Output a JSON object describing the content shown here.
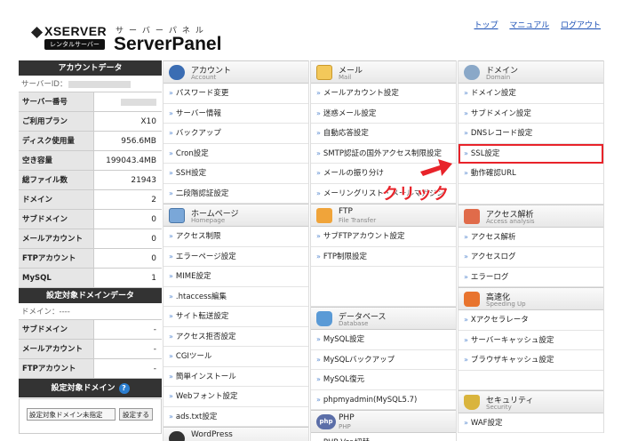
{
  "header": {
    "logo_text": "XSERVER",
    "logo_badge": "レンタルサーバー",
    "panel_sub": "サーバーパネル",
    "panel_title": "ServerPanel",
    "links": [
      "トップ",
      "マニュアル",
      "ログアウト"
    ]
  },
  "sidebar": {
    "account_title": "アカウントデータ",
    "server_id_label": "サーバーID：",
    "account_rows": [
      {
        "label": "サーバー番号",
        "value": ""
      },
      {
        "label": "ご利用プラン",
        "value": "X10"
      },
      {
        "label": "ディスク使用量",
        "value": "956.6MB"
      },
      {
        "label": "空き容量",
        "value": "199043.4MB"
      },
      {
        "label": "総ファイル数",
        "value": "21943"
      },
      {
        "label": "ドメイン",
        "value": "2"
      },
      {
        "label": "サブドメイン",
        "value": "0"
      },
      {
        "label": "メールアカウント",
        "value": "0"
      },
      {
        "label": "FTPアカウント",
        "value": "0"
      },
      {
        "label": "MySQL",
        "value": "1"
      }
    ],
    "domain_data_title": "設定対象ドメインデータ",
    "domain_label": "ドメイン：----",
    "domain_rows": [
      {
        "label": "サブドメイン",
        "value": "-"
      },
      {
        "label": "メールアカウント",
        "value": "-"
      },
      {
        "label": "FTPアカウント",
        "value": "-"
      }
    ],
    "target_domain_title": "設定対象ドメイン",
    "select_value": "設定対象ドメイン未指定",
    "set_button": "設定する"
  },
  "columns": {
    "account": {
      "title": "アカウント",
      "sub": "Account",
      "items": [
        "パスワード変更",
        "サーバー情報",
        "バックアップ",
        "Cron設定",
        "SSH設定",
        "二段階認証設定"
      ]
    },
    "homepage": {
      "title": "ホームページ",
      "sub": "Homepage",
      "items": [
        "アクセス制限",
        "エラーページ設定",
        "MIME設定",
        ".htaccess編集",
        "サイト転送設定",
        "アクセス拒否設定",
        "CGIツール",
        "簡単インストール",
        "Webフォント設定",
        "ads.txt設定"
      ]
    },
    "wordpress": {
      "title": "WordPress"
    },
    "mail": {
      "title": "メール",
      "sub": "Mail",
      "items": [
        "メールアカウント設定",
        "迷惑メール設定",
        "自動応答設定",
        "SMTP認証の国外アクセス制限設定",
        "メールの振り分け",
        "メーリングリスト・メールマガジン"
      ]
    },
    "ftp": {
      "title": "FTP",
      "sub": "File Transfer",
      "items": [
        "サブFTPアカウント設定",
        "FTP制限設定"
      ]
    },
    "database": {
      "title": "データベース",
      "sub": "Database",
      "items": [
        "MySQL設定",
        "MySQLバックアップ",
        "MySQL復元",
        "phpmyadmin(MySQL5.7)"
      ]
    },
    "php": {
      "title": "PHP",
      "sub": "PHP",
      "items": [
        "PHP Ver.切替"
      ]
    },
    "domain": {
      "title": "ドメイン",
      "sub": "Domain",
      "items": [
        "ドメイン設定",
        "サブドメイン設定",
        "DNSレコード設定",
        "SSL設定",
        "動作確認URL"
      ]
    },
    "access": {
      "title": "アクセス解析",
      "sub": "Access analysis",
      "items": [
        "アクセス解析",
        "アクセスログ",
        "エラーログ"
      ]
    },
    "speed": {
      "title": "高速化",
      "sub": "Speeding Up",
      "items": [
        "Xアクセラレータ",
        "サーバーキャッシュ設定",
        "ブラウザキャッシュ設定"
      ]
    },
    "security": {
      "title": "セキュリティ",
      "sub": "Security",
      "items": [
        "WAF設定"
      ]
    }
  },
  "annotation": {
    "text": "クリック",
    "color": "#e8232a"
  },
  "colors": {
    "link": "#1a4fb5",
    "sidebar_head": "#333333",
    "highlight": "#e8232a"
  }
}
